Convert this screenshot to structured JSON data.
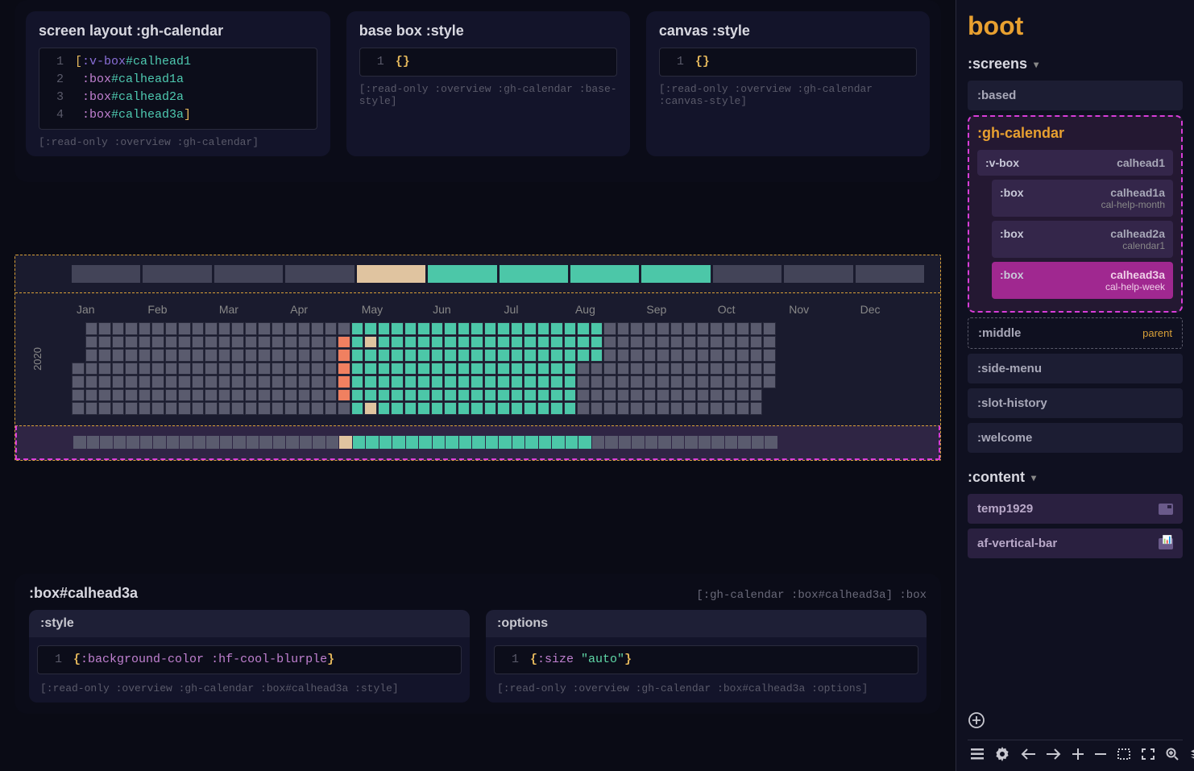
{
  "app_title": "boot",
  "top_panels": {
    "layout": {
      "title": "screen layout :gh-calendar",
      "code": [
        {
          "n": "1",
          "text": "[:v-box#calhead1"
        },
        {
          "n": "2",
          "text": " :box#calhead1a"
        },
        {
          "n": "3",
          "text": " :box#calhead2a"
        },
        {
          "n": "4",
          "text": " :box#calhead3a]"
        }
      ],
      "meta": "[:read-only :overview :gh-calendar]"
    },
    "base": {
      "title": "base box :style",
      "code": [
        {
          "n": "1",
          "text": "{}"
        }
      ],
      "meta": "[:read-only :overview :gh-calendar :base-style]"
    },
    "canvas": {
      "title": "canvas :style",
      "code": [
        {
          "n": "1",
          "text": "{}"
        }
      ],
      "meta": "[:read-only :overview :gh-calendar :canvas-style]"
    }
  },
  "calendar": {
    "year": "2020",
    "months": [
      "Jan",
      "Feb",
      "Mar",
      "Apr",
      "May",
      "Jun",
      "Jul",
      "Aug",
      "Sep",
      "Oct",
      "Nov",
      "Dec"
    ]
  },
  "detail": {
    "title": ":box#calhead3a",
    "crumb": "[:gh-calendar :box#calhead3a] :box",
    "style": {
      "title": ":style",
      "code_n": "1",
      "code": "{:background-color :hf-cool-blurple}",
      "meta": "[:read-only :overview :gh-calendar :box#calhead3a :style]"
    },
    "options": {
      "title": ":options",
      "code_n": "1",
      "code": "{:size \"auto\"}",
      "meta": "[:read-only :overview :gh-calendar :box#calhead3a :options]"
    }
  },
  "sidebar": {
    "screens_label": ":screens",
    "content_label": ":content",
    "items": {
      "based": ":based",
      "middle": {
        "label": ":middle",
        "tag": "parent"
      },
      "sidemenu": ":side-menu",
      "slothistory": ":slot-history",
      "welcome": ":welcome"
    },
    "group": {
      "title": ":gh-calendar",
      "tree": [
        {
          "l": ":v-box",
          "r": "calhead1",
          "sub": "",
          "indent": 0
        },
        {
          "l": ":box",
          "r": "calhead1a",
          "sub": "cal-help-month",
          "indent": 1
        },
        {
          "l": ":box",
          "r": "calhead2a",
          "sub": "calendar1",
          "indent": 1
        },
        {
          "l": ":box",
          "r": "calhead3a",
          "sub": "cal-help-week",
          "indent": 1,
          "selected": true
        }
      ]
    },
    "content": [
      {
        "label": "temp1929",
        "icon": "panel"
      },
      {
        "label": "af-vertical-bar",
        "icon": "chart"
      }
    ]
  }
}
